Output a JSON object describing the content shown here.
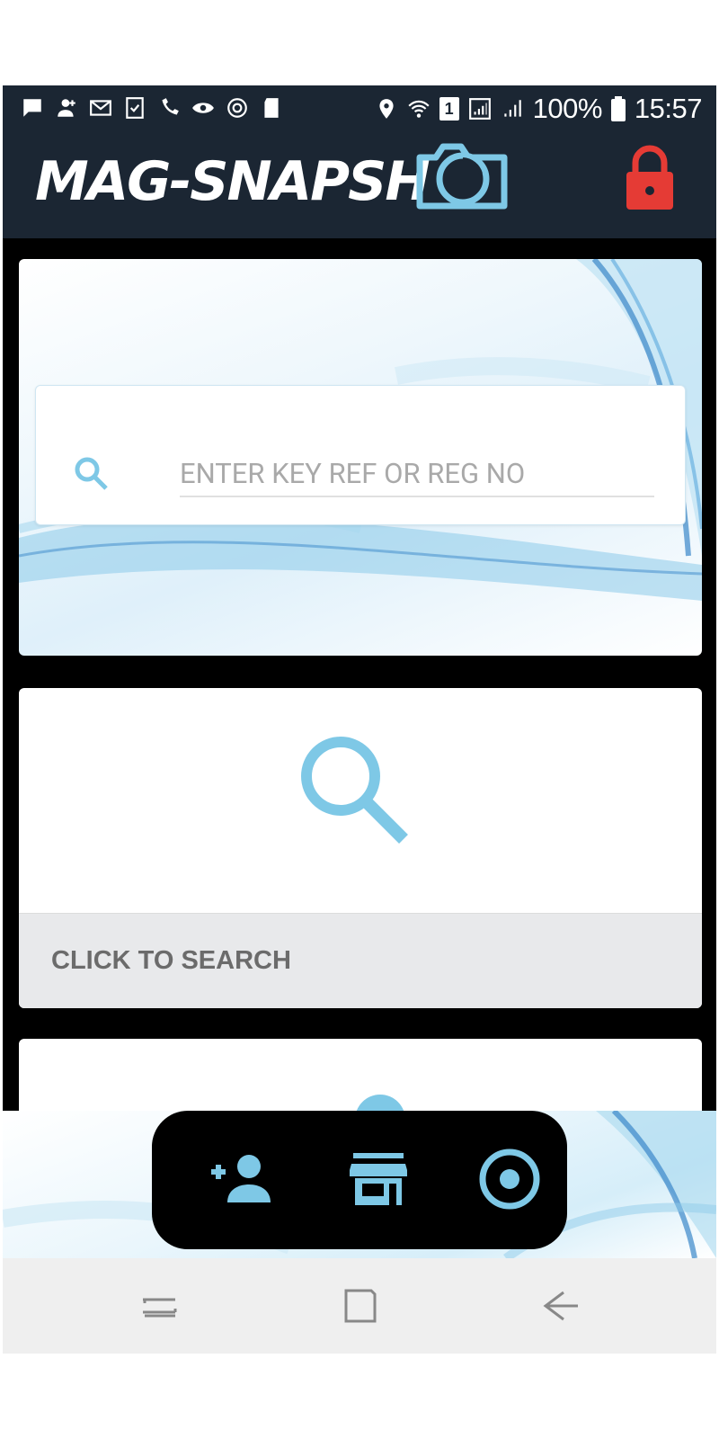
{
  "status_bar": {
    "battery_percent": "100%",
    "time": "15:57",
    "sim_slot": "1",
    "left_icons": [
      "message-icon",
      "add-contact-icon",
      "gmail-icon",
      "task-icon",
      "wifi-call-icon",
      "visibility-icon",
      "sync-icon",
      "sd-card-icon"
    ],
    "right_icons": [
      "location-icon",
      "wifi-icon",
      "sim-icon",
      "signal-icon",
      "signal-2-icon",
      "battery-icon"
    ]
  },
  "app_bar": {
    "logo_text": "MAG-SNAPSH",
    "logo_icon": "camera-icon",
    "lock_icon": "lock-icon",
    "lock_color": "#e53b35"
  },
  "search": {
    "placeholder": "ENTER KEY REF OR REG NO",
    "value": "",
    "icon": "search-icon"
  },
  "click_card": {
    "label": "CLICK TO SEARCH",
    "icon": "search-icon"
  },
  "fab_bar": {
    "items": [
      "add-person-icon",
      "store-icon",
      "record-icon"
    ]
  },
  "nav_bar": {
    "items": [
      "recent-apps-icon",
      "home-icon",
      "back-icon"
    ]
  },
  "colors": {
    "accent": "#7ec8e6",
    "header_bg": "#1b2633",
    "lock": "#e53b35",
    "footer_bg": "#e8e9eb"
  }
}
